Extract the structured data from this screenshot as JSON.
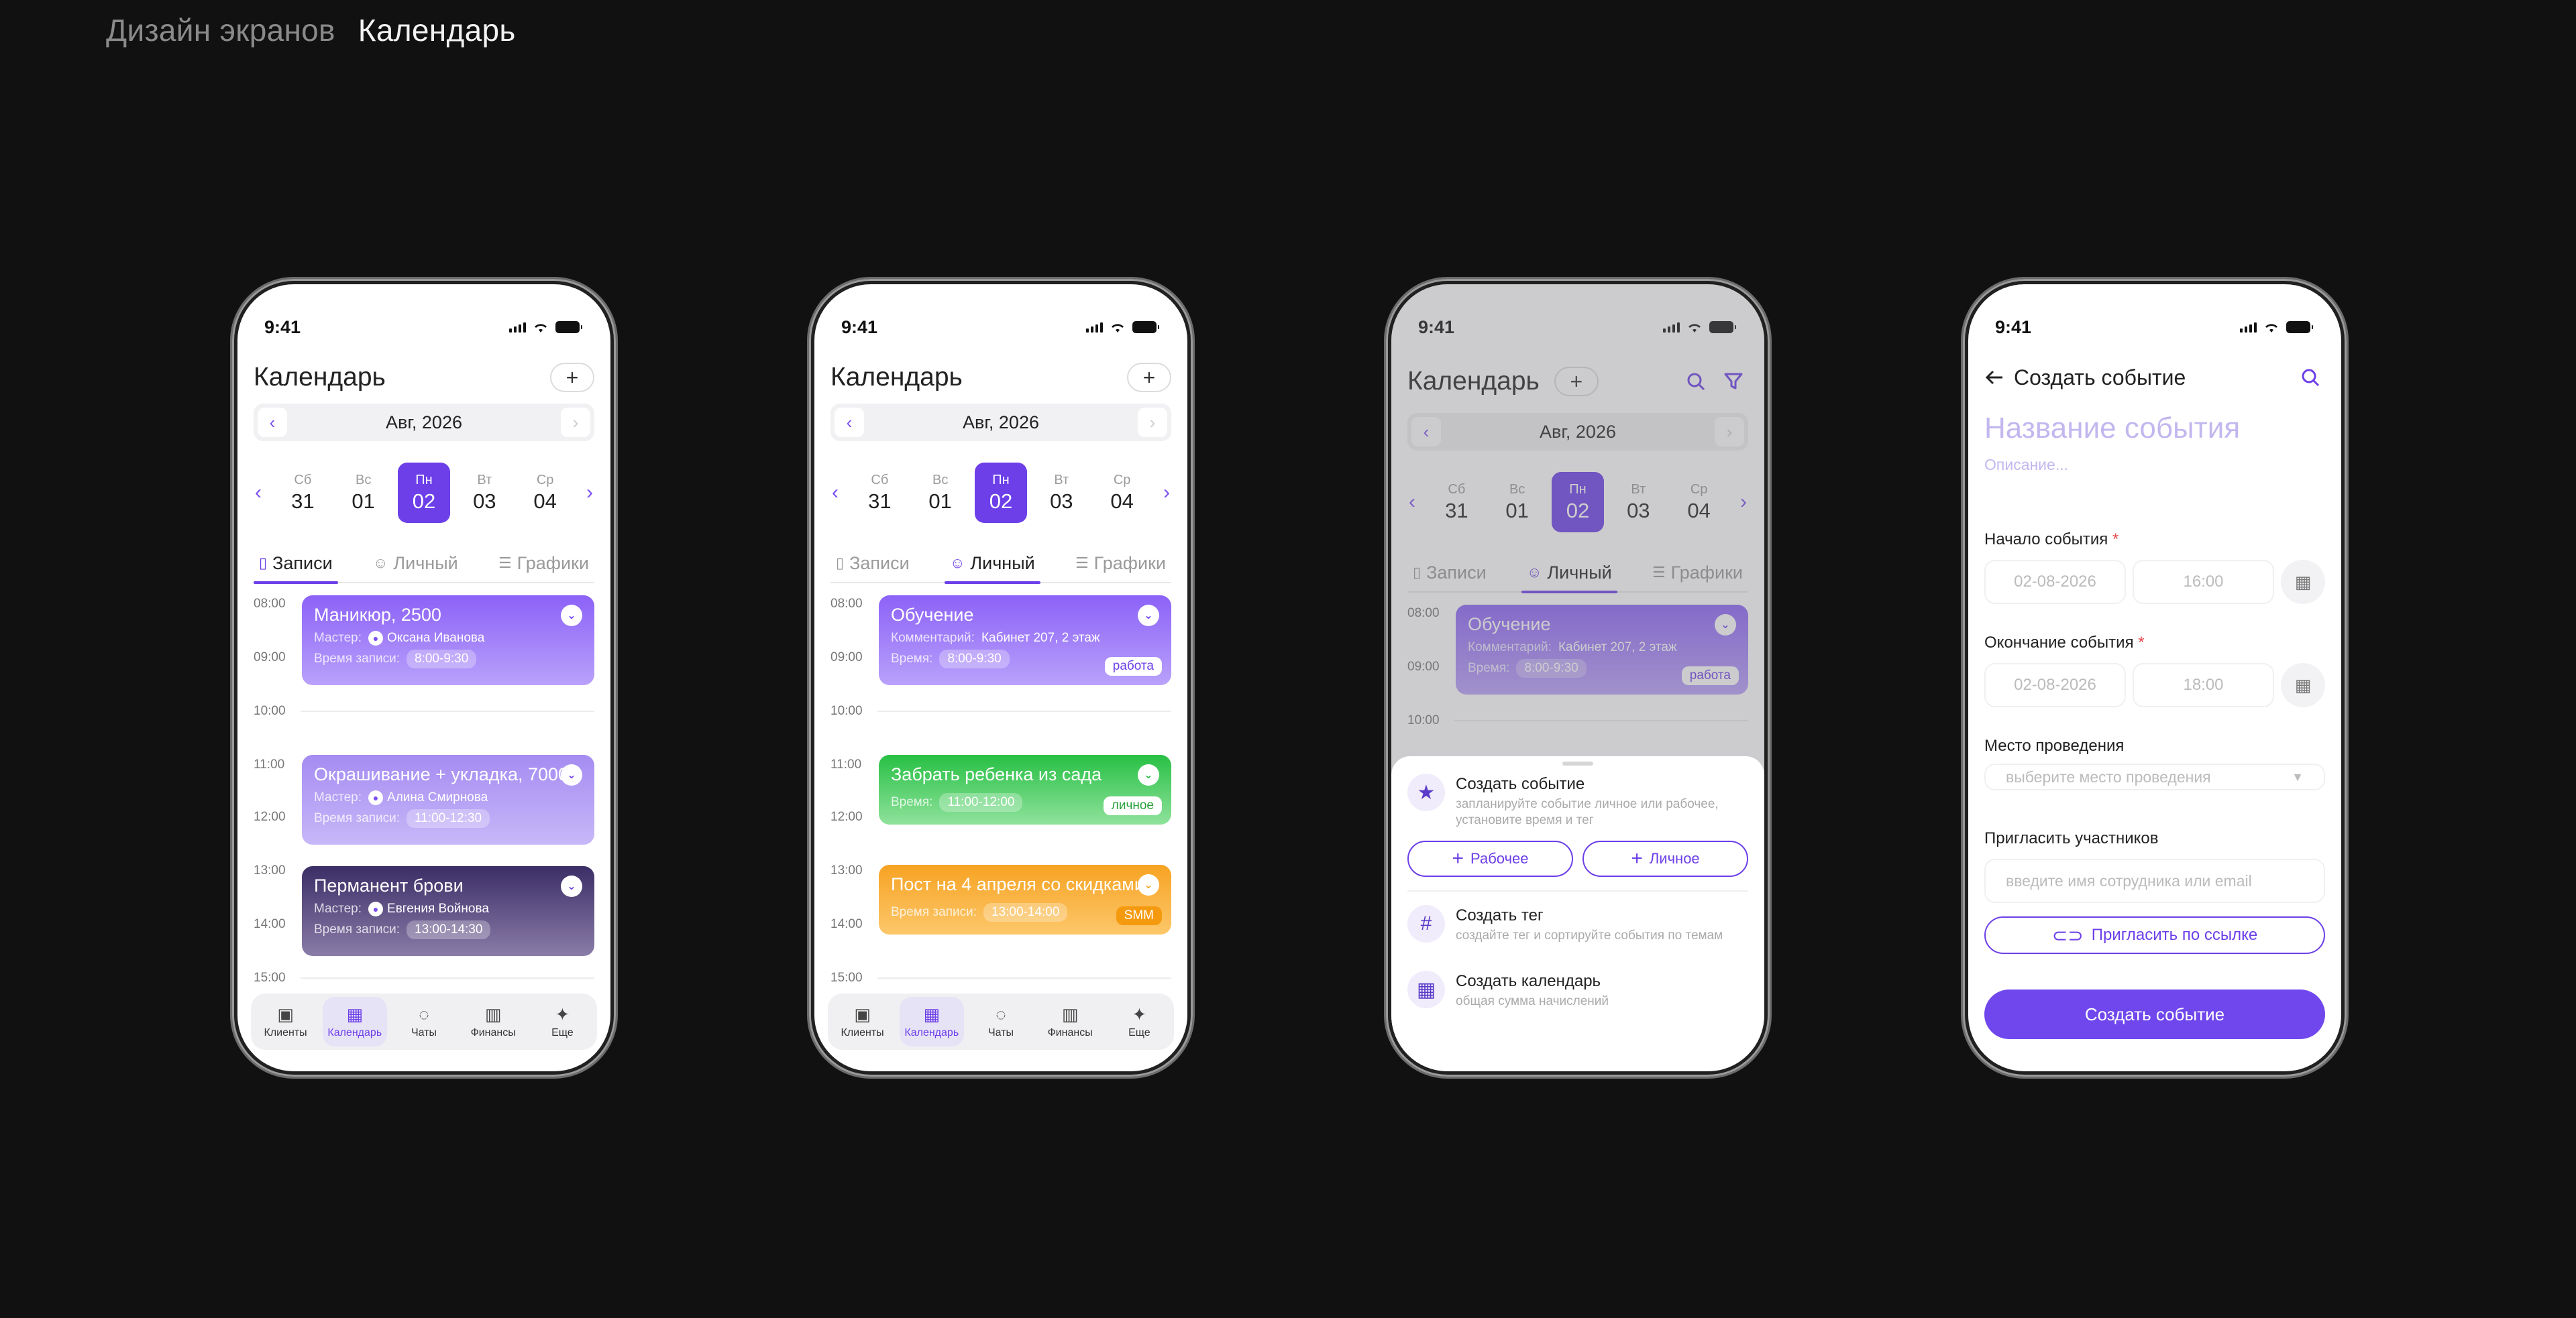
{
  "heading": {
    "crumb": "Дизайн экранов",
    "current": "Календарь"
  },
  "status": {
    "time": "9:41"
  },
  "calendar": {
    "title": "Календарь",
    "add": "+",
    "month": "Авг, 2026",
    "prev": "‹",
    "next": "›",
    "days": [
      {
        "name": "Сб",
        "num": "31"
      },
      {
        "name": "Вс",
        "num": "01"
      },
      {
        "name": "Пн",
        "num": "02"
      },
      {
        "name": "Вт",
        "num": "03"
      },
      {
        "name": "Ср",
        "num": "04"
      }
    ],
    "tabs": {
      "records": "Записи",
      "personal": "Личный",
      "schedules": "Графики"
    }
  },
  "times": [
    "08:00",
    "09:00",
    "10:00",
    "11:00",
    "12:00",
    "13:00",
    "14:00",
    "15:00"
  ],
  "phone1": {
    "events": [
      {
        "title": "Маникюр, 2500",
        "master_label": "Мастер:",
        "master": "Оксана Иванова",
        "time_label": "Время записи:",
        "time": "8:00-9:30"
      },
      {
        "title": "Окрашивание + укладка, 7000",
        "master_label": "Мастер:",
        "master": "Алина Смирнова",
        "time_label": "Время записи:",
        "time": "11:00-12:30"
      },
      {
        "title": "Перманент брови",
        "master_label": "Мастер:",
        "master": "Евгения Войнова",
        "time_label": "Время записи:",
        "time": "13:00-14:30"
      }
    ]
  },
  "phone2": {
    "events": [
      {
        "title": "Обучение",
        "comment_label": "Комментарий:",
        "comment": "Кабинет 207, 2 этаж",
        "time_label": "Время:",
        "time": "8:00-9:30",
        "tag": "работа"
      },
      {
        "title": "Забрать ребенка из сада",
        "time_label": "Время:",
        "time": "11:00-12:00",
        "tag": "личное"
      },
      {
        "title": "Пост на 4 апреля со скидками",
        "time_label": "Время записи:",
        "time": "13:00-14:00",
        "tag": "SMM"
      }
    ]
  },
  "nav": [
    "Клиенты",
    "Календарь",
    "Чаты",
    "Финансы",
    "Еще"
  ],
  "sheet": {
    "create_event_title": "Создать событие",
    "create_event_desc": "запланируйте событие личное или рабочее, установите время и тег",
    "work_btn": "Рабочее",
    "personal_btn": "Личное",
    "create_tag_title": "Создать тег",
    "create_tag_desc": "создайте тег и сортируйте события по темам",
    "create_calendar_title": "Создать календарь",
    "create_calendar_desc": "общая сумма начислений"
  },
  "form": {
    "header": "Создать событие",
    "name_placeholder": "Название события",
    "desc_placeholder": "Описание...",
    "start_label": "Начало события",
    "start_date": "02-08-2026",
    "start_time": "16:00",
    "end_label": "Окончание события",
    "end_date": "02-08-2026",
    "end_time": "18:00",
    "place_label": "Место проведения",
    "place_placeholder": "выберите место проведения",
    "invite_label": "Пригласить участников",
    "invite_placeholder": "введите имя сотрудника или email",
    "invite_link": "Пригласить по ссылке",
    "submit": "Создать событие",
    "required": "*"
  },
  "colors": {
    "accent": "#6c3fe8",
    "background": "#111111"
  }
}
